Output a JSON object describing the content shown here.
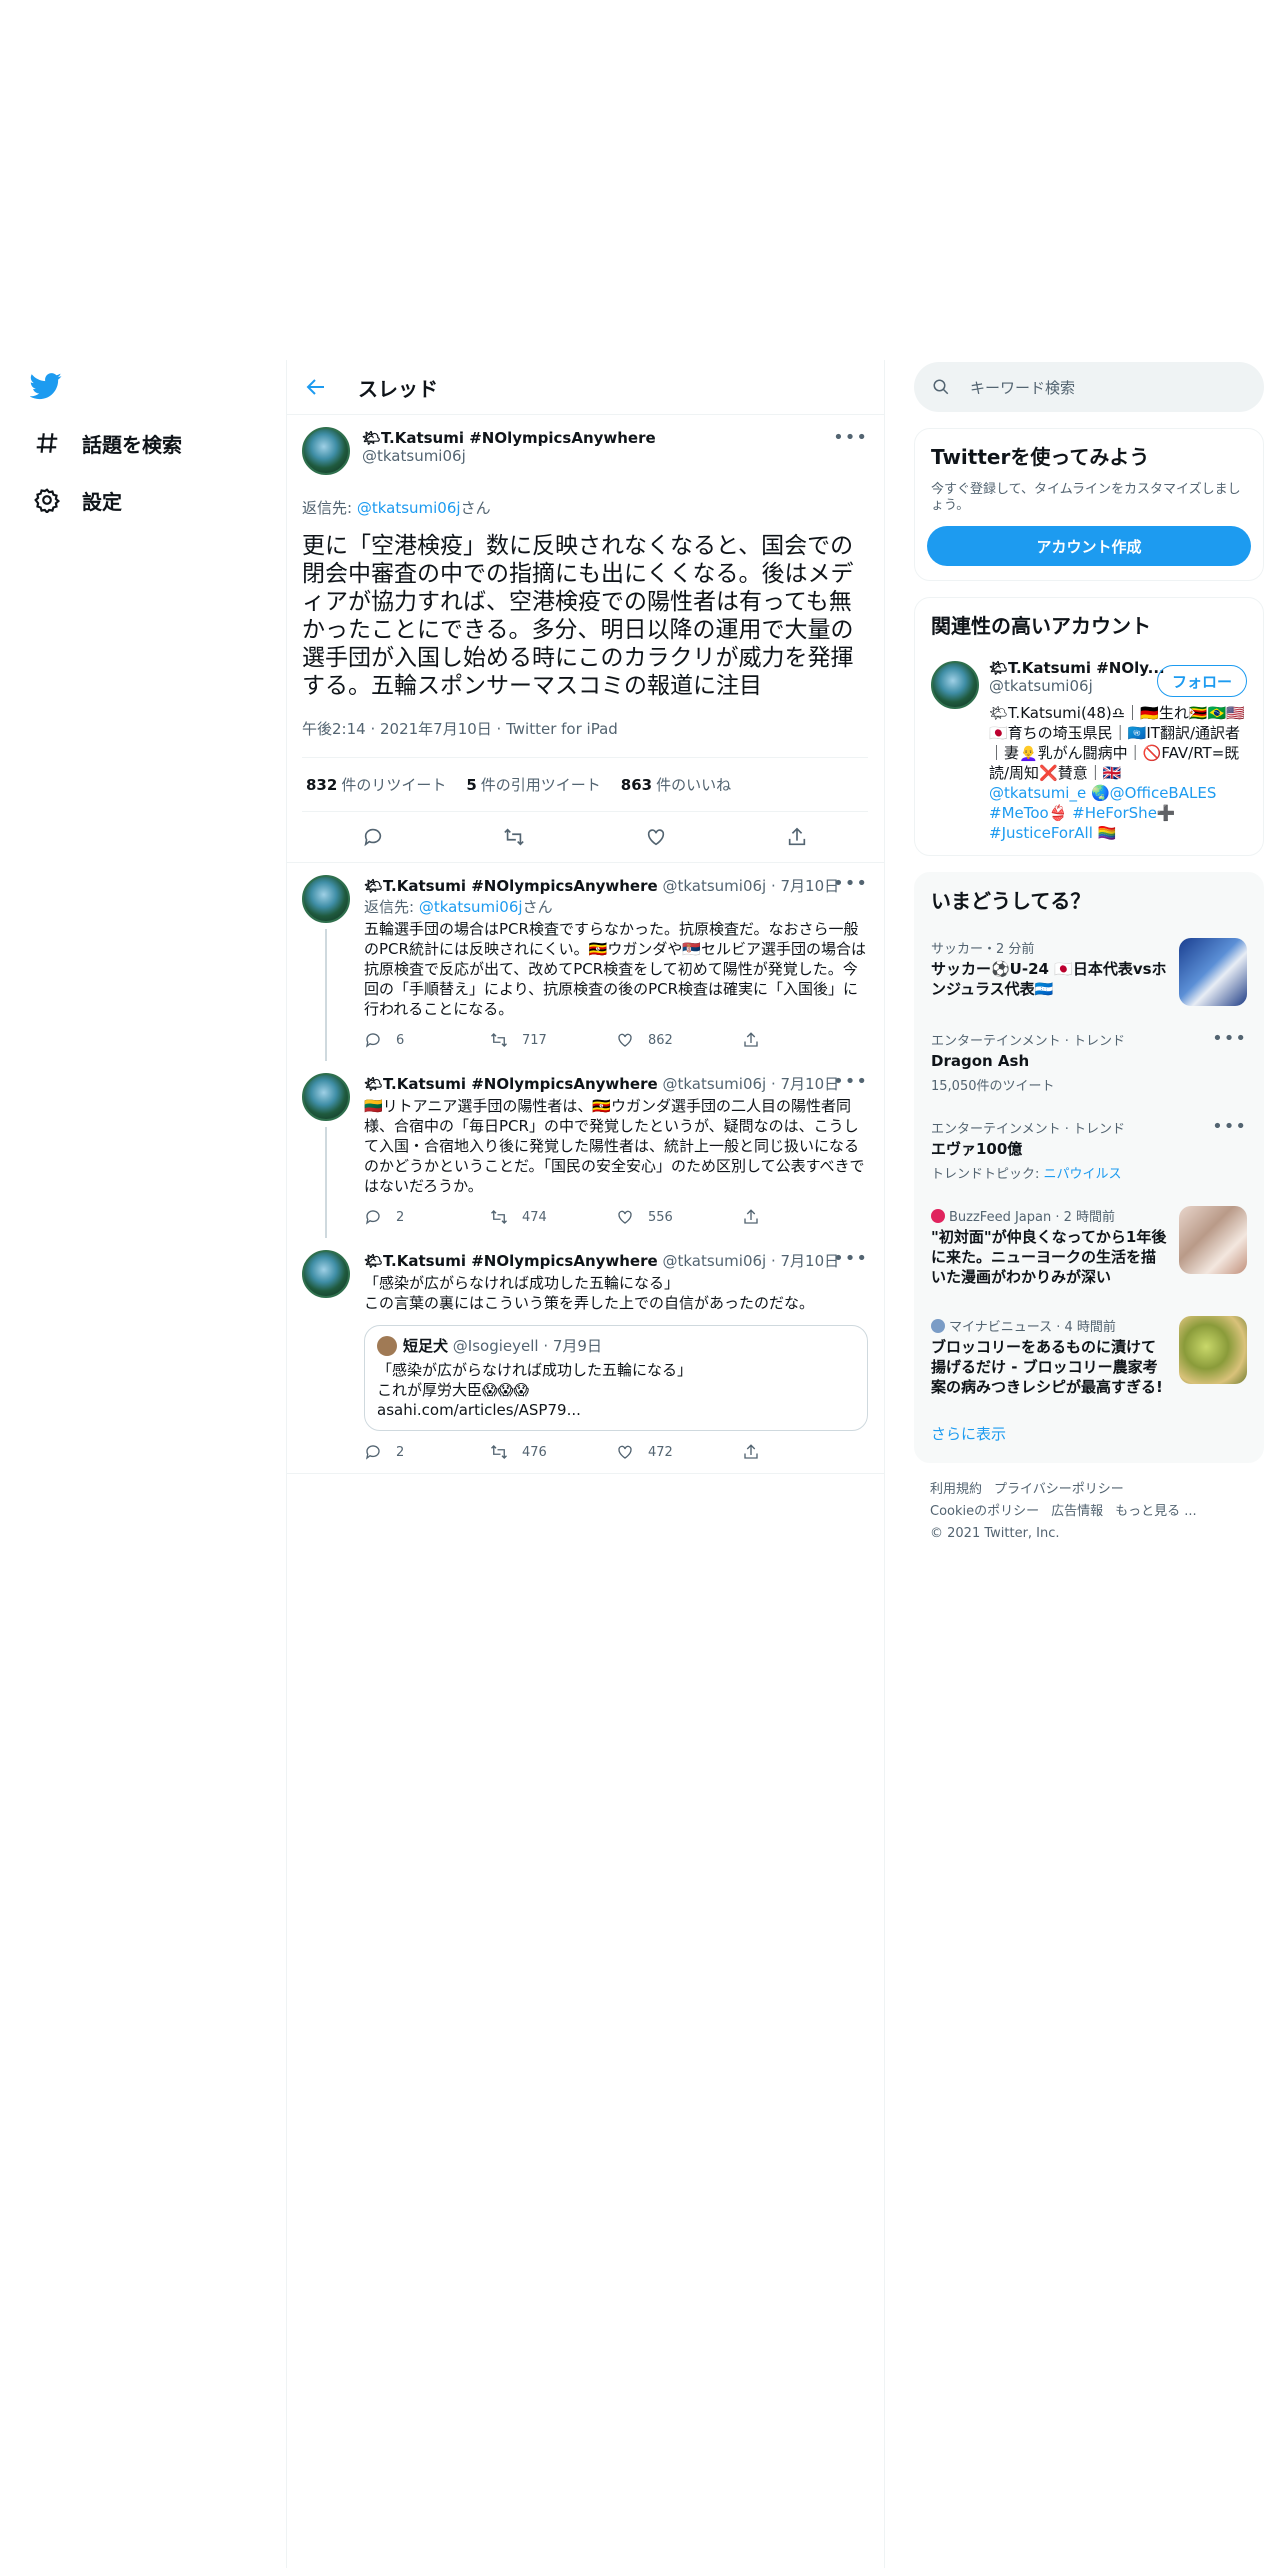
{
  "nav": {
    "explore_label": "話題を検索",
    "settings_label": "設定"
  },
  "thread": {
    "header_title": "スレッド",
    "focal": {
      "name": "🌤T.Katsumi #NOlympicsAnywhere",
      "handle": "@tkatsumi06j",
      "reply_prefix": "返信先: ",
      "reply_handle": "@tkatsumi06j",
      "reply_suffix": "さん",
      "text": "更に「空港検疫」数に反映されなくなると、国会での閉会中審査の中での指摘にも出にくくなる。後はメディアが協力すれば、空港検疫での陽性者は有っても無かったことにできる。多分、明日以降の運用で大量の選手団が入国し始める時にこのカラクリが威力を発揮する。五輪スポンサーマスコミの報道に注目",
      "time": "午後2:14 · 2021年7月10日 · Twitter for iPad",
      "retweets_count": "832",
      "retweets_label": "件のリツイート",
      "quotes_count": "5",
      "quotes_label": "件の引用ツイート",
      "likes_count": "863",
      "likes_label": "件のいいね"
    },
    "replies": [
      {
        "name": "🌤T.Katsumi #NOlympicsAnywhere",
        "meta": "@tkatsumi06j · 7月10日",
        "reply_prefix": "返信先: ",
        "reply_handle": "@tkatsumi06j",
        "reply_suffix": "さん",
        "text": "五輪選手団の場合はPCR検査ですらなかった。抗原検査だ。なおさら一般のPCR統計には反映されにくい。🇺🇬ウガンダや🇷🇸セルビア選手団の場合は抗原検査で反応が出て、改めてPCR検査をして初めて陽性が発覚した。今回の「手順替え」により、抗原検査の後のPCR検査は確実に「入国後」に行われることになる。",
        "replies": "6",
        "retweets": "717",
        "likes": "862"
      },
      {
        "name": "🌤T.Katsumi #NOlympicsAnywhere",
        "meta": "@tkatsumi06j · 7月10日",
        "text": "🇱🇹リトアニア選手団の陽性者は、🇺🇬ウガンダ選手団の二人目の陽性者同様、合宿中の「毎日PCR」の中で発覚したというが、疑問なのは、こうして入国・合宿地入り後に発覚した陽性者は、統計上一般と同じ扱いになるのかどうかということだ。「国民の安全安心」のため区別して公表すべきではないだろうか。",
        "replies": "2",
        "retweets": "474",
        "likes": "556"
      },
      {
        "name": "🌤T.Katsumi #NOlympicsAnywhere",
        "meta": "@tkatsumi06j · 7月10日",
        "text": "「感染が広がらなければ成功した五輪になる」\nこの言葉の裏にはこういう策を弄した上での自信があったのだな。",
        "quote": {
          "name": "短足犬",
          "meta": "@Isogieyell · 7月9日",
          "text": "「感染が広がらなければ成功した五輪になる」\nこれが厚労大臣😱😱😱\n asahi.com/articles/ASP79..."
        },
        "replies": "2",
        "retweets": "476",
        "likes": "472"
      }
    ]
  },
  "sidebar": {
    "search_placeholder": "キーワード検索",
    "signup": {
      "title": "Twitterを使ってみよう",
      "subtitle": "今すぐ登録して、タイムラインをカスタマイズしましょう。",
      "button": "アカウント作成"
    },
    "relevant": {
      "title": "関連性の高いアカウント",
      "name": "🌤T.Katsumi #NOly...",
      "handle": "@tkatsumi06j",
      "follow": "フォロー",
      "bio": "🌤T.Katsumi(48)♎｜🇩🇪生れ🇿🇼🇧🇷🇺🇸🇯🇵育ちの埼玉県民｜🇺🇳IT翻訳/通訳者｜妻👩‍🦲乳がん闘病中｜🚫FAV/RT=既読/周知❌賛意｜🇬🇧",
      "bio_links": "@tkatsumi_e 🌏@OfficeBALES #MeToo👙 #HeForShe➕ #JusticeForAll 🏳️‍🌈"
    },
    "trends": {
      "title": "いまどうしてる？",
      "items": [
        {
          "category": "サッカー・2 分前",
          "title": "サッカー⚽U-24 🇯🇵日本代表vsホンジュラス代表🇭🇳",
          "count": ""
        },
        {
          "category": "エンターテインメント · トレンド",
          "title": "Dragon Ash",
          "count": "15,050件のツイート"
        },
        {
          "category": "エンターテインメント · トレンド",
          "title": "エヴァ100億",
          "count_prefix": "トレンドトピック: ",
          "count_link": "ニパウイルス"
        },
        {
          "category": "BuzzFeed Japan · 2 時間前",
          "title": "\"初対面\"が仲良くなってから1年後に来た。ニューヨークの生活を描いた漫画がわかりみが深い"
        },
        {
          "category": "マイナビニュース · 4 時間前",
          "title": "ブロッコリーをあるものに漬けて揚げるだけ - ブロッコリー農家考案の病みつきレシピが最高すぎる!"
        }
      ],
      "show_more": "さらに表示"
    },
    "footer": {
      "terms": "利用規約",
      "privacy": "プライバシーポリシー",
      "cookie": "Cookieのポリシー",
      "ads": "広告情報",
      "more": "もっと見る ...",
      "copyright": "© 2021 Twitter, Inc."
    }
  },
  "colors": {
    "accent": "#1d9bf0",
    "text_primary": "#0f1419",
    "text_secondary": "#536471",
    "border": "#eff3f4"
  }
}
